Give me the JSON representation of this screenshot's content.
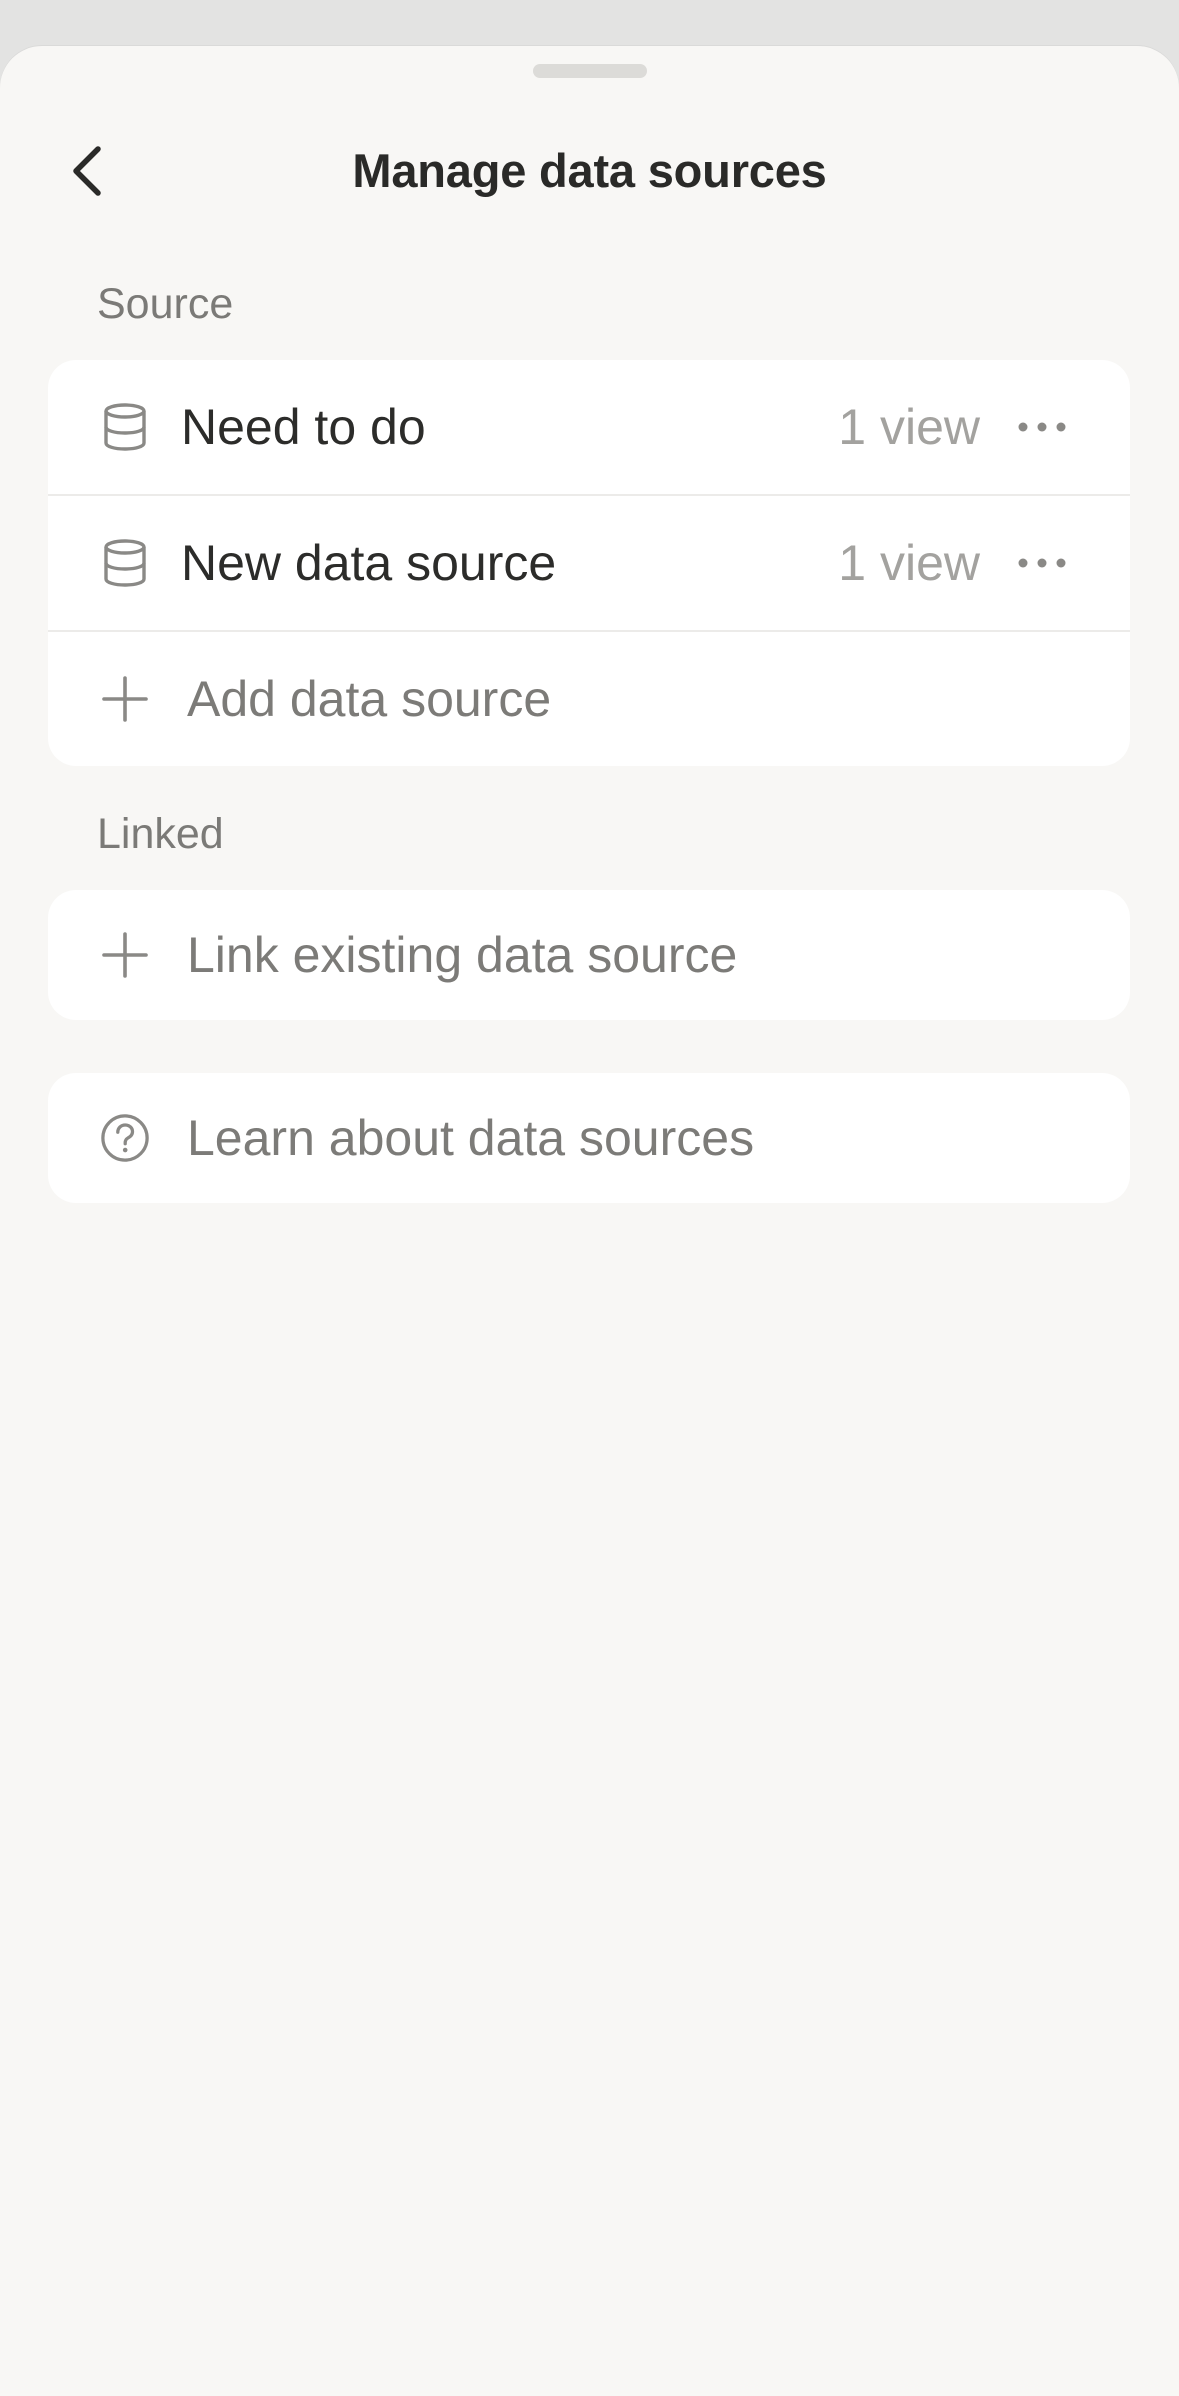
{
  "header": {
    "title": "Manage data sources",
    "back_icon": "chevron-left-icon"
  },
  "sections": {
    "source": {
      "label": "Source",
      "items": [
        {
          "label": "Need to do",
          "count": "1 view",
          "icon": "database-icon"
        },
        {
          "label": "New data source",
          "count": "1 view",
          "icon": "database-icon"
        }
      ],
      "add_label": "Add data source"
    },
    "linked": {
      "label": "Linked",
      "link_label": "Link existing data source"
    },
    "help": {
      "label": "Learn about data sources",
      "icon": "question-circle-icon"
    }
  },
  "colors": {
    "sheet_background": "#f8f7f5",
    "card_background": "#ffffff",
    "primary_text": "#2c2c2a",
    "secondary_text": "#7c7b78",
    "tertiary_text": "#a3a29f"
  }
}
